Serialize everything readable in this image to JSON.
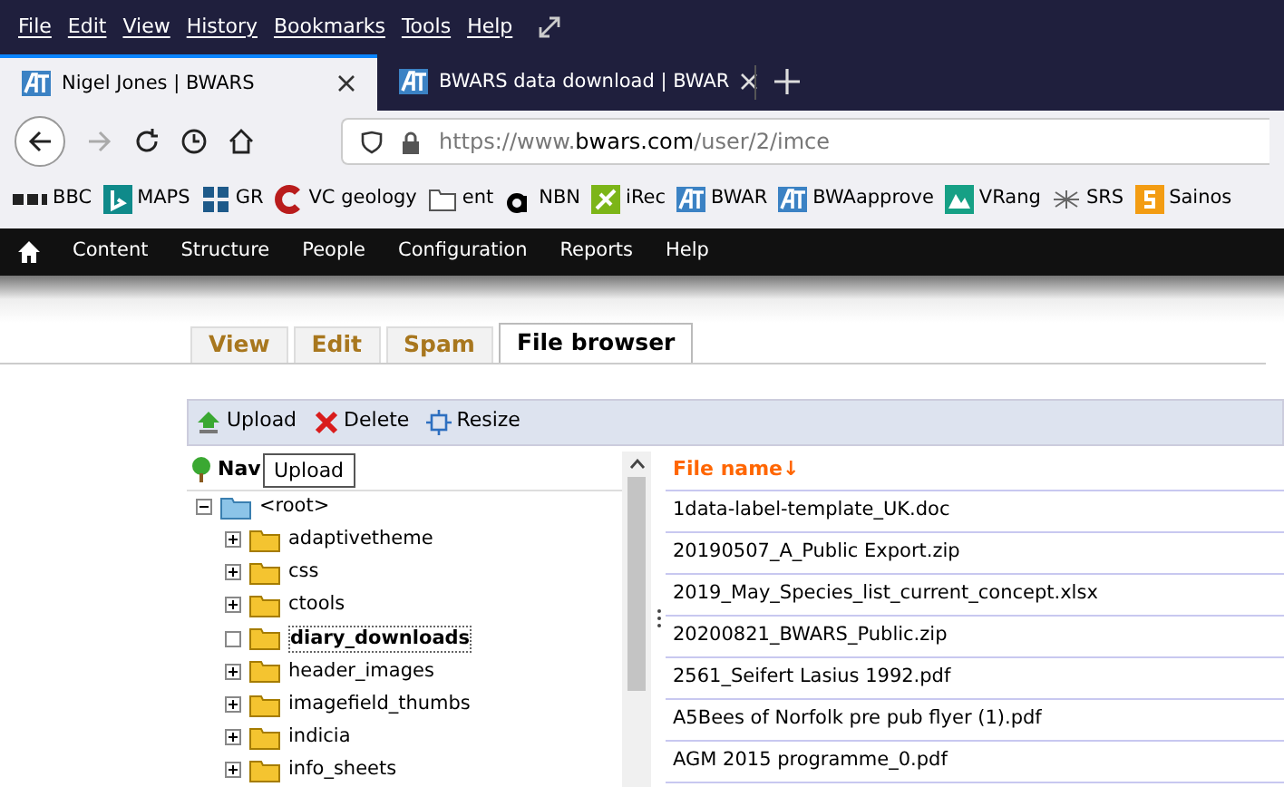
{
  "menu_bar": {
    "items": [
      "File",
      "Edit",
      "View",
      "History",
      "Bookmarks",
      "Tools",
      "Help"
    ]
  },
  "browser_tabs": [
    {
      "title": "Nigel Jones | BWARS",
      "selected": true
    },
    {
      "title": "BWARS data download | BWAR",
      "selected": false
    }
  ],
  "address_bar": {
    "prefix": "https://www.",
    "domain": "bwars.com",
    "path": "/user/2/imce"
  },
  "bookmarks": [
    {
      "label": "BBC",
      "kind": "bbc"
    },
    {
      "label": "MAPS",
      "kind": "bing"
    },
    {
      "label": "GR",
      "kind": "grid"
    },
    {
      "label": "VC geology",
      "kind": "c"
    },
    {
      "label": "ent",
      "kind": "folder"
    },
    {
      "label": "NBN",
      "kind": "a"
    },
    {
      "label": "iRec",
      "kind": "irec"
    },
    {
      "label": "BWAR",
      "kind": "at"
    },
    {
      "label": "BWAapprove",
      "kind": "at"
    },
    {
      "label": "VRang",
      "kind": "vrang"
    },
    {
      "label": "SRS",
      "kind": "spider"
    },
    {
      "label": "Sainos",
      "kind": "s"
    }
  ],
  "admin_menu": [
    "Content",
    "Structure",
    "People",
    "Configuration",
    "Reports",
    "Help"
  ],
  "page_tabs": [
    {
      "label": "View",
      "selected": false
    },
    {
      "label": "Edit",
      "selected": false
    },
    {
      "label": "Spam",
      "selected": false
    },
    {
      "label": "File browser",
      "selected": true
    }
  ],
  "toolbar": [
    {
      "label": "Upload",
      "kind": "upload"
    },
    {
      "label": "Delete",
      "kind": "delete"
    },
    {
      "label": "Resize",
      "kind": "resize"
    }
  ],
  "navigation": {
    "title": "Nav",
    "tooltip": "Upload"
  },
  "tree": {
    "label": "<root>",
    "expanded": true,
    "children": [
      {
        "label": "adaptivetheme",
        "selected": false,
        "has_children": true
      },
      {
        "label": "css",
        "selected": false,
        "has_children": true
      },
      {
        "label": "ctools",
        "selected": false,
        "has_children": true
      },
      {
        "label": "diary_downloads",
        "selected": true,
        "has_children": false
      },
      {
        "label": "header_images",
        "selected": false,
        "has_children": true
      },
      {
        "label": "imagefield_thumbs",
        "selected": false,
        "has_children": true
      },
      {
        "label": "indicia",
        "selected": false,
        "has_children": true
      },
      {
        "label": "info_sheets",
        "selected": false,
        "has_children": true
      }
    ]
  },
  "file_table": {
    "column": "File name↓",
    "rows": [
      "1data-label-template_UK.doc",
      "20190507_A_Public Export.zip",
      "2019_May_Species_list_current_concept.xlsx",
      "20200821_BWARS_Public.zip",
      "2561_Seifert Lasius 1992.pdf",
      "A5Bees of Norfolk pre pub flyer (1).pdf",
      "AGM 2015 programme_0.pdf"
    ]
  }
}
